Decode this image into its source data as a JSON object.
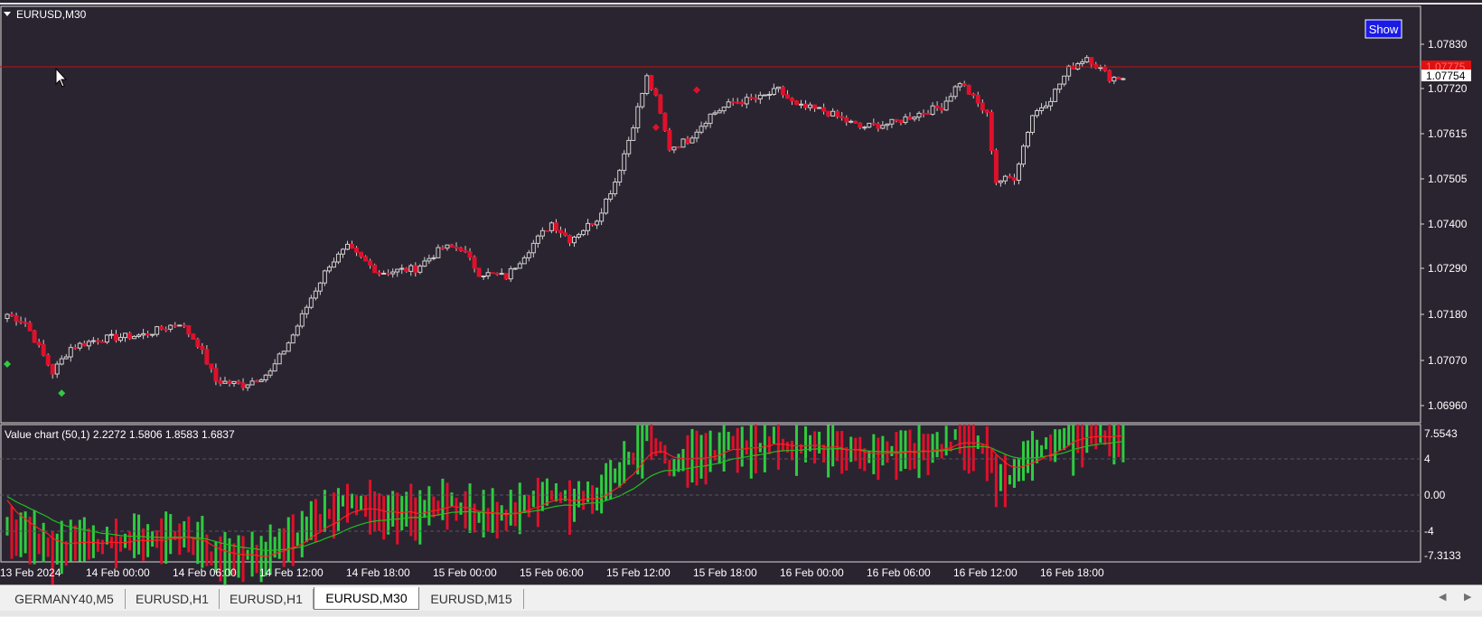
{
  "chart_window": {
    "symbol_label": "EURUSD,M30",
    "show_button": "Show"
  },
  "indicator": {
    "label": "Value chart (50,1) 2.2272 1.5806 1.8583 1.6837"
  },
  "price_axis": {
    "labels": [
      "1.07830",
      "1.07720",
      "1.07615",
      "1.07505",
      "1.07400",
      "1.07290",
      "1.07180",
      "1.07070",
      "1.06960"
    ],
    "current_price": "1.07754",
    "line_price": "1.07775"
  },
  "indicator_axis": {
    "labels": [
      "7.5543",
      "4",
      "0.00",
      "-4",
      "-7.3133"
    ]
  },
  "time_axis": {
    "labels": [
      "13 Feb 2024",
      "14 Feb 00:00",
      "14 Feb 06:00",
      "14 Feb 12:00",
      "14 Feb 18:00",
      "15 Feb 00:00",
      "15 Feb 06:00",
      "15 Feb 12:00",
      "15 Feb 18:00",
      "16 Feb 00:00",
      "16 Feb 06:00",
      "16 Feb 12:00",
      "16 Feb 18:00"
    ]
  },
  "tabs": [
    {
      "label": "GERMANY40,M5"
    },
    {
      "label": "EURUSD,H1"
    },
    {
      "label": "EURUSD,H1"
    },
    {
      "label": "EURUSD,M30",
      "active": true
    },
    {
      "label": "EURUSD,M15"
    }
  ],
  "colors": {
    "background": "#2a2430",
    "bull": "#2ecc40",
    "bear": "#e0102a",
    "ma_fast": "#ff2020",
    "ma_slow": "#20c020",
    "hline": "#c01010"
  },
  "chart_data": {
    "type": "candlestick",
    "timeframe": "M30",
    "y_range": [
      1.0693,
      1.0788
    ],
    "price_keyframes": [
      [
        0,
        1.0718
      ],
      [
        4,
        1.0716
      ],
      [
        8,
        1.0708
      ],
      [
        10,
        1.0704
      ],
      [
        14,
        1.071
      ],
      [
        20,
        1.0712
      ],
      [
        30,
        1.0713
      ],
      [
        38,
        1.0716
      ],
      [
        42,
        1.0711
      ],
      [
        46,
        1.0702
      ],
      [
        52,
        1.0701
      ],
      [
        58,
        1.0704
      ],
      [
        63,
        1.0713
      ],
      [
        67,
        1.0722
      ],
      [
        71,
        1.073
      ],
      [
        75,
        1.0734
      ],
      [
        82,
        1.0728
      ],
      [
        90,
        1.0729
      ],
      [
        96,
        1.0734
      ],
      [
        100,
        1.0734
      ],
      [
        104,
        1.0728
      ],
      [
        110,
        1.0727
      ],
      [
        116,
        1.0735
      ],
      [
        120,
        1.074
      ],
      [
        124,
        1.0736
      ],
      [
        130,
        1.0741
      ],
      [
        134,
        1.075
      ],
      [
        137,
        1.076
      ],
      [
        141,
        1.0775
      ],
      [
        143,
        1.077
      ],
      [
        146,
        1.0758
      ],
      [
        150,
        1.076
      ],
      [
        155,
        1.0766
      ],
      [
        160,
        1.0769
      ],
      [
        166,
        1.077
      ],
      [
        170,
        1.0772
      ],
      [
        174,
        1.0768
      ],
      [
        180,
        1.0767
      ],
      [
        188,
        1.0763
      ],
      [
        195,
        1.0764
      ],
      [
        200,
        1.0766
      ],
      [
        206,
        1.0768
      ],
      [
        210,
        1.0774
      ],
      [
        216,
        1.0766
      ],
      [
        218,
        1.075
      ],
      [
        222,
        1.0751
      ],
      [
        226,
        1.0766
      ],
      [
        230,
        1.077
      ],
      [
        234,
        1.0777
      ],
      [
        238,
        1.078
      ],
      [
        243,
        1.0775
      ],
      [
        246,
        1.0775
      ]
    ],
    "signals": [
      {
        "bar": 0,
        "price": 1.0706,
        "color": "#2ecc40"
      },
      {
        "bar": 12,
        "price": 1.0699,
        "color": "#2ecc40"
      },
      {
        "bar": 143,
        "price": 1.0763,
        "color": "#e0102a"
      },
      {
        "bar": 152,
        "price": 1.0772,
        "color": "#e0102a"
      }
    ],
    "indicator_range": [
      -7.3133,
      7.5543
    ]
  }
}
